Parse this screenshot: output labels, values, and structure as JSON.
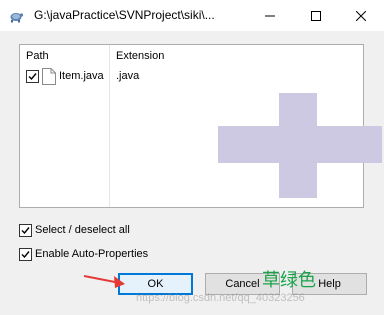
{
  "window": {
    "title": "G:\\javaPractice\\SVNProject\\siki\\...",
    "minimize_glyph": "—",
    "maximize_glyph": "☐",
    "close_glyph": "✕"
  },
  "list": {
    "columns": [
      "Path",
      "Extension"
    ],
    "rows": [
      {
        "checked": true,
        "path": "Item.java",
        "extension": ".java"
      }
    ]
  },
  "options": {
    "select_all_label": "Select / deselect all",
    "select_all_checked": true,
    "auto_props_label": "Enable Auto-Properties",
    "auto_props_checked": true
  },
  "buttons": {
    "ok": "OK",
    "cancel": "Cancel",
    "help": "Help"
  },
  "annotation": {
    "label": "草绿色",
    "label_color": "#1aa34a",
    "arrow_color": "#e53935"
  },
  "watermark": "https://blog.csdn.net/qq_40323256",
  "icons": {
    "app": "tortoise-svn-icon",
    "file": "file-icon",
    "overlay": "added-plus-icon"
  }
}
